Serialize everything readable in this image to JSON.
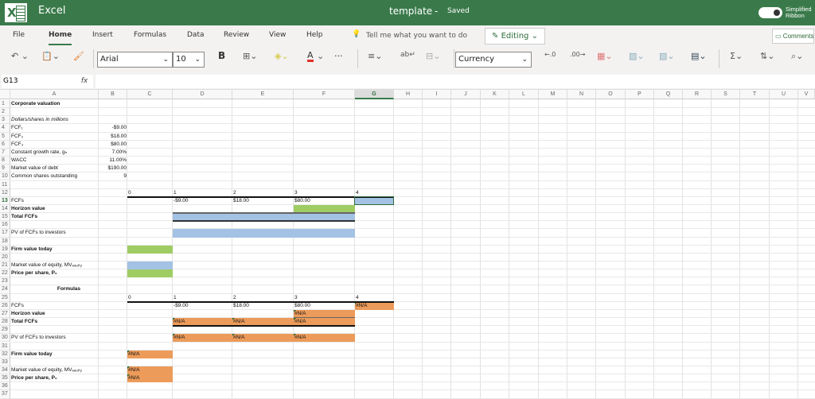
{
  "app": {
    "name": "Excel",
    "doc_title": "template",
    "separator": "-",
    "status": "Saved",
    "simplified": "Simplified Ribbon"
  },
  "menu": {
    "tabs": [
      "File",
      "Home",
      "Insert",
      "Formulas",
      "Data",
      "Review",
      "View",
      "Help"
    ],
    "active": "Home",
    "tell_me": "Tell me what you want to do",
    "editing": "Editing",
    "comments": "Comments"
  },
  "toolbar": {
    "font": "Arial",
    "size": "10",
    "bold": "B",
    "number_format": "Currency",
    "more": "···"
  },
  "formula_bar": {
    "name_box": "G13",
    "fx": "fx",
    "formula": ""
  },
  "colors": {
    "green": "#9fcc63",
    "blue": "#a3c2e4",
    "orange": "#ec9b5a",
    "brand": "#3a7a4a"
  },
  "columns": [
    "A",
    "B",
    "C",
    "D",
    "E",
    "F",
    "G",
    "H",
    "I",
    "J",
    "K",
    "L",
    "M",
    "N",
    "O",
    "P",
    "Q",
    "R",
    "S",
    "T",
    "U",
    "V"
  ],
  "selected": {
    "col": "G",
    "row": 13
  },
  "rows": 37,
  "cells": [
    {
      "r": 1,
      "c": "A",
      "v": "Corporate valuation",
      "s": "b"
    },
    {
      "r": 3,
      "c": "A",
      "v": "Dollars/shares in millions",
      "s": "i"
    },
    {
      "r": 4,
      "c": "A",
      "v": "FCF₁"
    },
    {
      "r": 4,
      "c": "B",
      "v": "-$9.00",
      "s": "r"
    },
    {
      "r": 5,
      "c": "A",
      "v": "FCF₂"
    },
    {
      "r": 5,
      "c": "B",
      "v": "$18.00",
      "s": "r"
    },
    {
      "r": 6,
      "c": "A",
      "v": "FCF₃"
    },
    {
      "r": 6,
      "c": "B",
      "v": "$80.00",
      "s": "r"
    },
    {
      "r": 7,
      "c": "A",
      "v": "Constant growth rate, gₙ"
    },
    {
      "r": 7,
      "c": "B",
      "v": "7.00%",
      "s": "r"
    },
    {
      "r": 8,
      "c": "A",
      "v": "WACC"
    },
    {
      "r": 8,
      "c": "B",
      "v": "11.00%",
      "s": "r"
    },
    {
      "r": 9,
      "c": "A",
      "v": "Market value of debt"
    },
    {
      "r": 9,
      "c": "B",
      "v": "$190.00",
      "s": "r"
    },
    {
      "r": 10,
      "c": "A",
      "v": "Common shares outstanding"
    },
    {
      "r": 10,
      "c": "B",
      "v": "9",
      "s": "r"
    },
    {
      "r": 12,
      "c": "C",
      "v": "0"
    },
    {
      "r": 12,
      "c": "D",
      "v": "1"
    },
    {
      "r": 12,
      "c": "E",
      "v": "2"
    },
    {
      "r": 12,
      "c": "F",
      "v": "3"
    },
    {
      "r": 12,
      "c": "G",
      "v": "4"
    },
    {
      "r": 13,
      "c": "A",
      "v": "FCFs"
    },
    {
      "r": 13,
      "c": "D",
      "v": "-$9.00"
    },
    {
      "r": 13,
      "c": "E",
      "v": "$18.00"
    },
    {
      "r": 13,
      "c": "F",
      "v": "$80.00"
    },
    {
      "r": 13,
      "c": "G",
      "v": "",
      "fill": "blue"
    },
    {
      "r": 14,
      "c": "A",
      "v": "Horizon value",
      "s": "b"
    },
    {
      "r": 14,
      "c": "F",
      "v": "",
      "fill": "green"
    },
    {
      "r": 15,
      "c": "A",
      "v": "  Total FCFs",
      "s": "b"
    },
    {
      "r": 15,
      "c": "D",
      "v": "",
      "fill": "blue",
      "span": 3
    },
    {
      "r": 17,
      "c": "A",
      "v": "PV of FCFs to investors"
    },
    {
      "r": 17,
      "c": "D",
      "v": "",
      "fill": "blue",
      "span": 3
    },
    {
      "r": 19,
      "c": "A",
      "v": "Firm value today",
      "s": "b"
    },
    {
      "r": 19,
      "c": "C",
      "v": "",
      "fill": "green"
    },
    {
      "r": 21,
      "c": "A",
      "v": "Market value of equity, MVₑₔᵤᵢₜᵧ"
    },
    {
      "r": 21,
      "c": "C",
      "v": "",
      "fill": "blue"
    },
    {
      "r": 22,
      "c": "A",
      "v": "Price per share, P₀",
      "s": "b"
    },
    {
      "r": 22,
      "c": "C",
      "v": "",
      "fill": "green"
    },
    {
      "r": 24,
      "c": "A",
      "v": "Formulas",
      "s": "b c",
      "span": 2
    },
    {
      "r": 25,
      "c": "C",
      "v": "0"
    },
    {
      "r": 25,
      "c": "D",
      "v": "1"
    },
    {
      "r": 25,
      "c": "E",
      "v": "2"
    },
    {
      "r": 25,
      "c": "F",
      "v": "3"
    },
    {
      "r": 25,
      "c": "G",
      "v": "4"
    },
    {
      "r": 26,
      "c": "A",
      "v": "FCFs"
    },
    {
      "r": 26,
      "c": "D",
      "v": "-$9.00"
    },
    {
      "r": 26,
      "c": "E",
      "v": "$18.00"
    },
    {
      "r": 26,
      "c": "F",
      "v": "$80.00"
    },
    {
      "r": 26,
      "c": "G",
      "v": "#N/A",
      "fill": "orange",
      "err": 1
    },
    {
      "r": 27,
      "c": "A",
      "v": "Horizon value",
      "s": "b"
    },
    {
      "r": 27,
      "c": "F",
      "v": "#N/A",
      "fill": "orange",
      "err": 1
    },
    {
      "r": 28,
      "c": "A",
      "v": "  Total FCFs",
      "s": "b"
    },
    {
      "r": 28,
      "c": "D",
      "v": "#N/A",
      "fill": "orange",
      "err": 1
    },
    {
      "r": 28,
      "c": "E",
      "v": "#N/A",
      "fill": "orange",
      "err": 1
    },
    {
      "r": 28,
      "c": "F",
      "v": "#N/A",
      "fill": "orange",
      "err": 1
    },
    {
      "r": 30,
      "c": "A",
      "v": "PV of FCFs to investors"
    },
    {
      "r": 30,
      "c": "D",
      "v": "#N/A",
      "fill": "orange",
      "err": 1
    },
    {
      "r": 30,
      "c": "E",
      "v": "#N/A",
      "fill": "orange",
      "err": 1
    },
    {
      "r": 30,
      "c": "F",
      "v": "#N/A",
      "fill": "orange",
      "err": 1
    },
    {
      "r": 32,
      "c": "A",
      "v": "Firm value today",
      "s": "b"
    },
    {
      "r": 32,
      "c": "C",
      "v": "#N/A",
      "fill": "orange",
      "err": 1
    },
    {
      "r": 34,
      "c": "A",
      "v": "Market value of equity, MVₑₔᵤᵢₜᵧ"
    },
    {
      "r": 34,
      "c": "C",
      "v": "#N/A",
      "fill": "orange",
      "err": 1
    },
    {
      "r": 35,
      "c": "A",
      "v": "Price per share, P₀",
      "s": "b"
    },
    {
      "r": 35,
      "c": "C",
      "v": "#N/A",
      "fill": "orange",
      "err": 1
    }
  ]
}
